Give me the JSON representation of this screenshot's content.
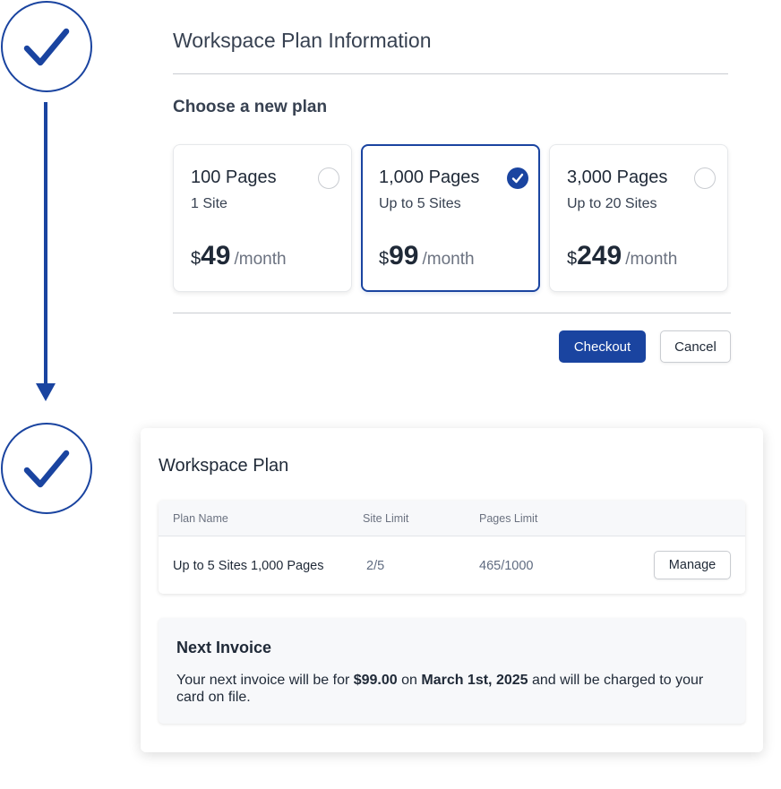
{
  "colors": {
    "accent": "#1a44a0",
    "border": "#c9ccd1",
    "muted_text": "#6b7280",
    "panel_bg": "#f7f8fa"
  },
  "steps": [
    {
      "icon": "check-icon"
    },
    {
      "icon": "check-icon"
    }
  ],
  "plan_selection": {
    "title": "Workspace Plan Information",
    "subtitle": "Choose a new plan",
    "plans": [
      {
        "pages": "100 Pages",
        "sites": "1 Site",
        "currency": "$",
        "price": "49",
        "period": "/month",
        "selected": false
      },
      {
        "pages": "1,000 Pages",
        "sites": "Up to 5 Sites",
        "currency": "$",
        "price": "99",
        "period": "/month",
        "selected": true
      },
      {
        "pages": "3,000 Pages",
        "sites": "Up to 20 Sites",
        "currency": "$",
        "price": "249",
        "period": "/month",
        "selected": false
      }
    ],
    "checkout_label": "Checkout",
    "cancel_label": "Cancel"
  },
  "workspace_plan": {
    "title": "Workspace Plan",
    "table": {
      "columns": [
        "Plan Name",
        "Site Limit",
        "Pages Limit"
      ],
      "rows": [
        {
          "plan_name": "Up to 5 Sites 1,000 Pages",
          "site_limit": "2/5",
          "pages_limit": "465/1000",
          "action": "Manage"
        }
      ]
    },
    "invoice": {
      "title": "Next Invoice",
      "text_1": "Your next invoice will be for ",
      "amount": "$99.00",
      "text_2": " on ",
      "date": "March 1st, 2025",
      "text_3": " and will be charged to your card on file."
    }
  }
}
